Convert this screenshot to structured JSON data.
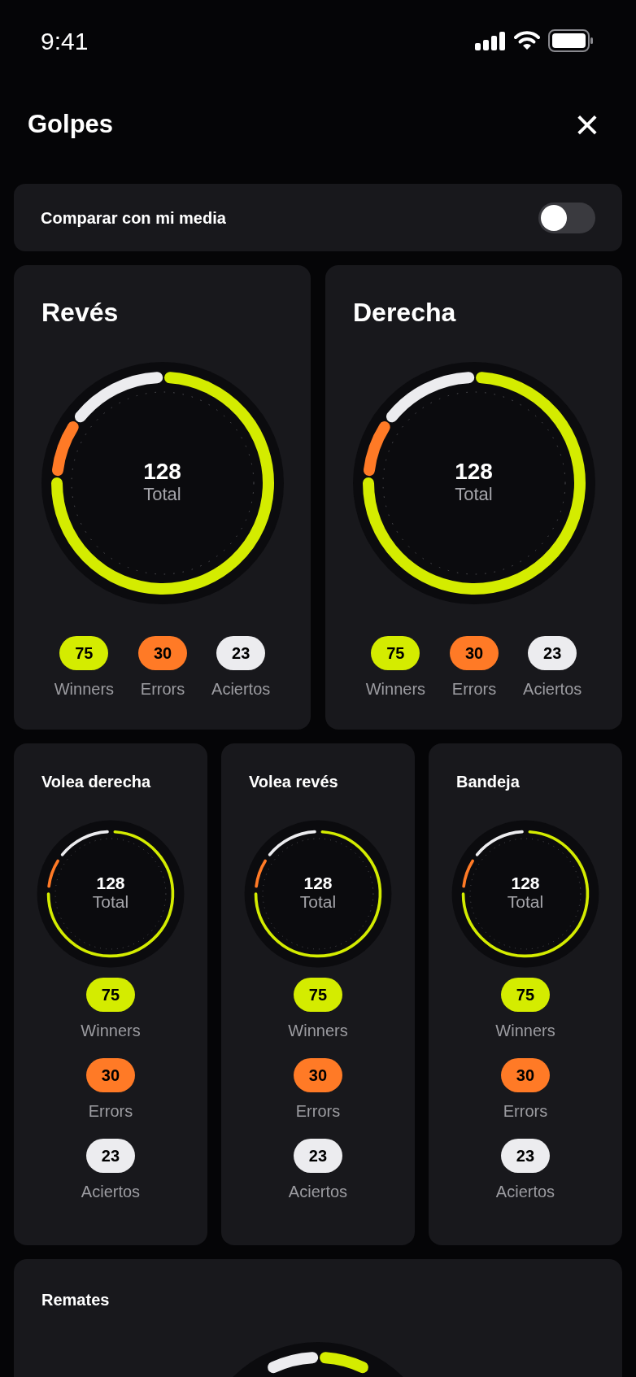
{
  "status_bar": {
    "time": "9:41"
  },
  "header": {
    "title": "Golpes",
    "close_icon": "×"
  },
  "compare_toggle": {
    "label": "Comparar con mi media",
    "on": false
  },
  "large_cards": [
    {
      "title": "Revés",
      "total": "128",
      "total_label": "Total",
      "stats": [
        {
          "value": "75",
          "label": "Winners",
          "color": "#d4ec00"
        },
        {
          "value": "30",
          "label": "Errors",
          "color": "#ff7a26"
        },
        {
          "value": "23",
          "label": "Aciertos",
          "color": "#ececef"
        }
      ]
    },
    {
      "title": "Derecha",
      "total": "128",
      "total_label": "Total",
      "stats": [
        {
          "value": "75",
          "label": "Winners",
          "color": "#d4ec00"
        },
        {
          "value": "30",
          "label": "Errors",
          "color": "#ff7a26"
        },
        {
          "value": "23",
          "label": "Aciertos",
          "color": "#ececef"
        }
      ]
    }
  ],
  "small_cards": [
    {
      "title": "Volea derecha",
      "total": "128",
      "total_label": "Total",
      "stats": [
        {
          "value": "75",
          "label": "Winners",
          "color": "#d4ec00"
        },
        {
          "value": "30",
          "label": "Errors",
          "color": "#ff7a26"
        },
        {
          "value": "23",
          "label": "Aciertos",
          "color": "#ececef"
        }
      ]
    },
    {
      "title": "Volea revés",
      "total": "128",
      "total_label": "Total",
      "stats": [
        {
          "value": "75",
          "label": "Winners",
          "color": "#d4ec00"
        },
        {
          "value": "30",
          "label": "Errors",
          "color": "#ff7a26"
        },
        {
          "value": "23",
          "label": "Aciertos",
          "color": "#ececef"
        }
      ]
    },
    {
      "title": "Bandeja",
      "total": "128",
      "total_label": "Total",
      "stats": [
        {
          "value": "75",
          "label": "Winners",
          "color": "#d4ec00"
        },
        {
          "value": "30",
          "label": "Errors",
          "color": "#ff7a26"
        },
        {
          "value": "23",
          "label": "Aciertos",
          "color": "#ececef"
        }
      ]
    }
  ],
  "bottom_card": {
    "title": "Remates"
  }
}
